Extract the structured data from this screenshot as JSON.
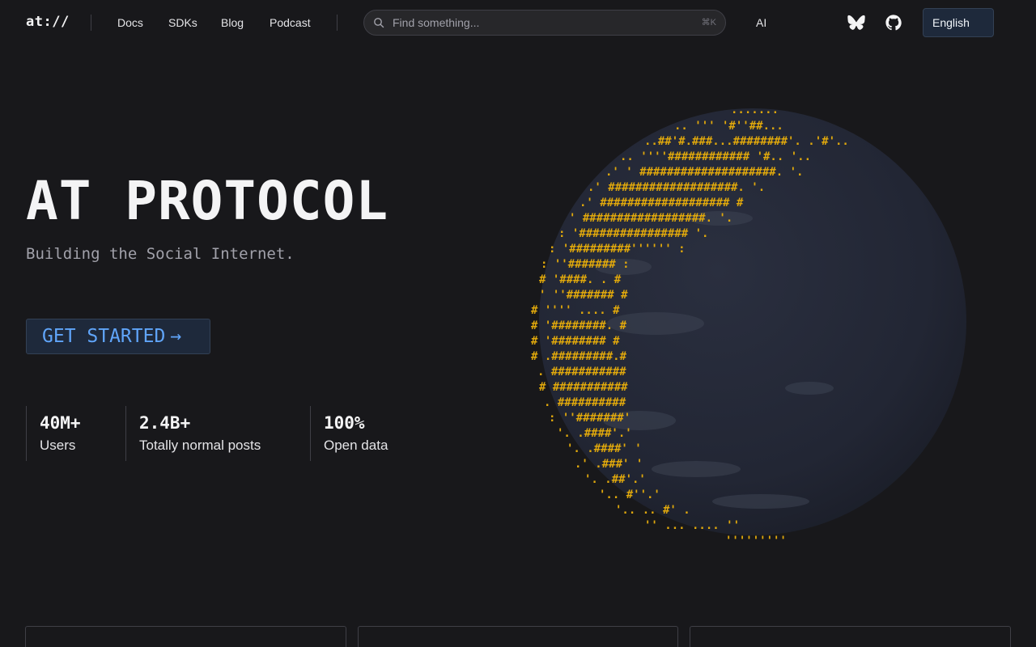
{
  "nav": {
    "logo": "at://",
    "links": [
      "Docs",
      "SDKs",
      "Blog",
      "Podcast"
    ],
    "search_placeholder": "Find something...",
    "search_shortcut": "⌘K",
    "ai_label": "AI",
    "icons": [
      "bluesky-butterfly-icon",
      "github-icon"
    ],
    "language": "English"
  },
  "hero": {
    "title": "AT PROTOCOL",
    "subtitle": "Building the Social Internet.",
    "cta_label": "GET STARTED",
    "cta_arrow": "→"
  },
  "stats": [
    {
      "value": "40M+",
      "label": "Users"
    },
    {
      "value": "2.4B+",
      "label": "Totally normal posts"
    },
    {
      "value": "100%",
      "label": "Open data"
    }
  ],
  "globe": {
    "accent": "#e0a80c",
    "ocean": "#232735"
  }
}
